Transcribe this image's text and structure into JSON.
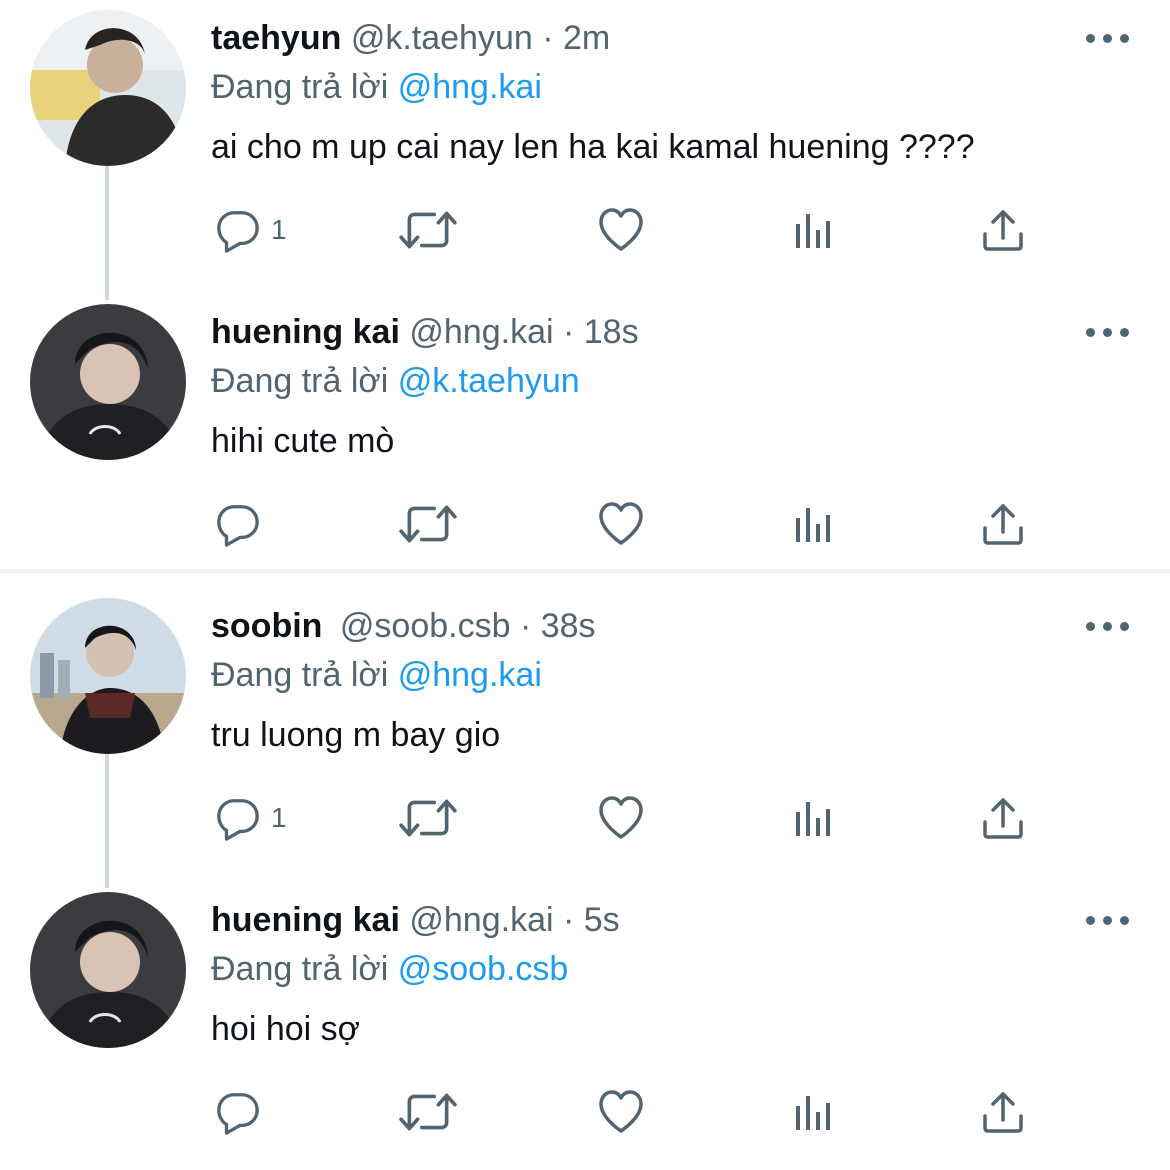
{
  "reply_prefix": "Đang trả lời",
  "colors": {
    "accent": "#1d9bf0",
    "secondary_text": "#536471",
    "thread_line": "#cfd9de"
  },
  "threads": [
    {
      "tweets": [
        {
          "name": "taehyun",
          "handle": "@k.taehyun",
          "dot": "·",
          "time": "2m",
          "reply_prefix": "Đang trả lời",
          "reply_to": "@hng.kai",
          "text": "ai cho m up cai nay len ha kai kamal huening ????",
          "reply_count": "1",
          "avatar_icon": "profile-photo"
        },
        {
          "name": "huening kai",
          "handle": "@hng.kai",
          "dot": "·",
          "time": "18s",
          "reply_prefix": "Đang trả lời",
          "reply_to": "@k.taehyun",
          "text": "hihi cute mò",
          "reply_count": "",
          "avatar_icon": "profile-photo"
        }
      ]
    },
    {
      "tweets": [
        {
          "name": "soobin",
          "handle": "@soob.csb",
          "dot": "·",
          "time": "38s",
          "reply_prefix": "Đang trả lời",
          "reply_to": "@hng.kai",
          "text": "tru luong m bay gio",
          "reply_count": "1",
          "avatar_icon": "profile-photo"
        },
        {
          "name": "huening kai",
          "handle": "@hng.kai",
          "dot": "·",
          "time": "5s",
          "reply_prefix": "Đang trả lời",
          "reply_to": "@soob.csb",
          "text": "hoi hoi sợ",
          "reply_count": "",
          "avatar_icon": "profile-photo"
        }
      ]
    }
  ],
  "action_icons": [
    "reply-icon",
    "retweet-icon",
    "like-icon",
    "views-icon",
    "share-icon"
  ]
}
